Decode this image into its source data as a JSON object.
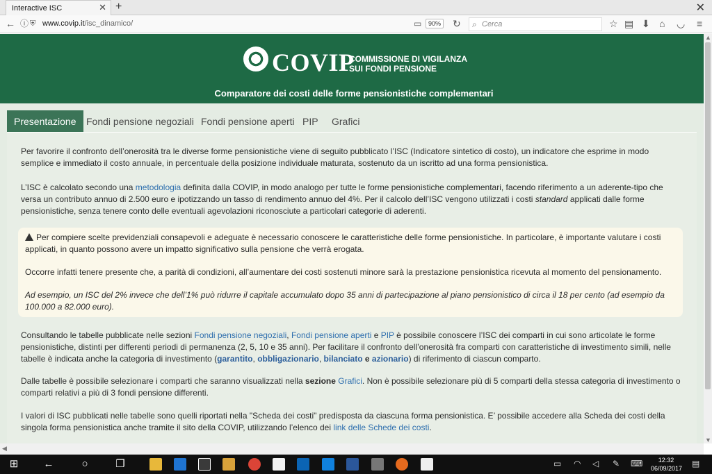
{
  "browser": {
    "tab_title": "Interactive ISC",
    "url_host": "www.covip.it",
    "url_path": "/isc_dinamico/",
    "zoom": "90%",
    "search_placeholder": "Cerca"
  },
  "header": {
    "logo_word": "COVIP",
    "logo_sub1": "COMMISSIONE DI VIGILANZA",
    "logo_sub2": "SUI FONDI PENSIONE",
    "subtitle": "Comparatore dei costi delle forme pensionistiche complementari"
  },
  "tabs": [
    {
      "label": "Presentazione"
    },
    {
      "label": "Fondi pensione negoziali"
    },
    {
      "label": "Fondi pensione aperti"
    },
    {
      "label": "PIP"
    },
    {
      "label": "Grafici"
    }
  ],
  "content": {
    "p1": "Per favorire il confronto dell’onerosità tra le diverse forme pensionistiche viene di seguito pubblicato l’ISC (Indicatore sintetico di costo), un indicatore che esprime in modo semplice e immediato il costo annuale, in percentuale della posizione individuale maturata, sostenuto da un iscritto ad una forma pensionistica.",
    "p2_a": "L’ISC è calcolato secondo una ",
    "p2_link": "metodologia",
    "p2_b": " definita dalla COVIP, in modo analogo per tutte le forme pensionistiche complementari, facendo riferimento a un aderente-tipo che versa un contributo annuo di 2.500 euro e ipotizzando un tasso di rendimento annuo del 4%. Per il calcolo dell’ISC vengono utilizzati i costi ",
    "p2_italic": "standard",
    "p2_c": " applicati dalle forme pensionistiche, senza tenere conto delle eventuali agevolazioni riconosciute a particolari categorie di aderenti.",
    "notice1": "Per compiere scelte previdenziali consapevoli e adeguate è necessario conoscere le caratteristiche delle forme pensionistiche. In particolare, è importante valutare i costi applicati, in quanto possono avere un impatto significativo sulla pensione che verrà erogata.",
    "notice2": "Occorre infatti tenere presente che, a parità di condizioni, all’aumentare dei costi sostenuti minore sarà la prestazione pensionistica ricevuta al momento del pensionamento.",
    "notice3": "Ad esempio, un ISC del 2% invece che dell’1% può ridurre il capitale accumulato dopo 35 anni di partecipazione al piano pensionistico di circa il 18 per cento (ad esempio da 100.000 a 82.000 euro).",
    "p3_a": "Consultando le tabelle pubblicate nelle sezioni ",
    "p3_link1": "Fondi pensione negoziali",
    "p3_comma": ", ",
    "p3_link2": "Fondi pensione aperti",
    "p3_e": " e ",
    "p3_link3": "PIP",
    "p3_b": " è possibile conoscere l’ISC dei comparti in cui sono articolate le forme pensionistiche, distinti per differenti periodi di permanenza (2, 5, 10 e 35 anni). Per facilitare il confronto dell’onerosità fra comparti con caratteristiche di investimento simili, nelle tabelle è indicata anche la categoria di investimento (",
    "p3_cat1": "garantito",
    "p3_sep1": ", ",
    "p3_cat2": "obbligazionario",
    "p3_sep2": ", ",
    "p3_cat3": "bilanciato",
    "p3_sep3": " e ",
    "p3_cat4": "azionario",
    "p3_c": ") di riferimento di ciascun comparto.",
    "p4_a": "Dalle tabelle è possibile selezionare i comparti che saranno visualizzati nella ",
    "p4_bold": "sezione",
    "p4_sp": " ",
    "p4_link": "Grafici",
    "p4_b": ". Non è possibile selezionare più di 5 comparti della stessa categoria di investimento o comparti relativi a più di 3 fondi pensione differenti.",
    "p5_a": "I valori di ISC pubblicati nelle tabelle sono quelli riportati nella \"Scheda dei costi\" predisposta da ciascuna forma pensionistica. E’ possibile accedere alla Scheda dei costi della singola forma pensionistica anche tramite il sito della COVIP, utilizzando l’elenco dei ",
    "p5_link": "link delle Schede dei costi",
    "p5_b": "."
  },
  "taskbar": {
    "time": "12:32",
    "date": "06/09/2017"
  },
  "colors": {
    "header_green": "#1e6a45",
    "active_tab": "#3b7457",
    "link_blue": "#2f6fae"
  }
}
